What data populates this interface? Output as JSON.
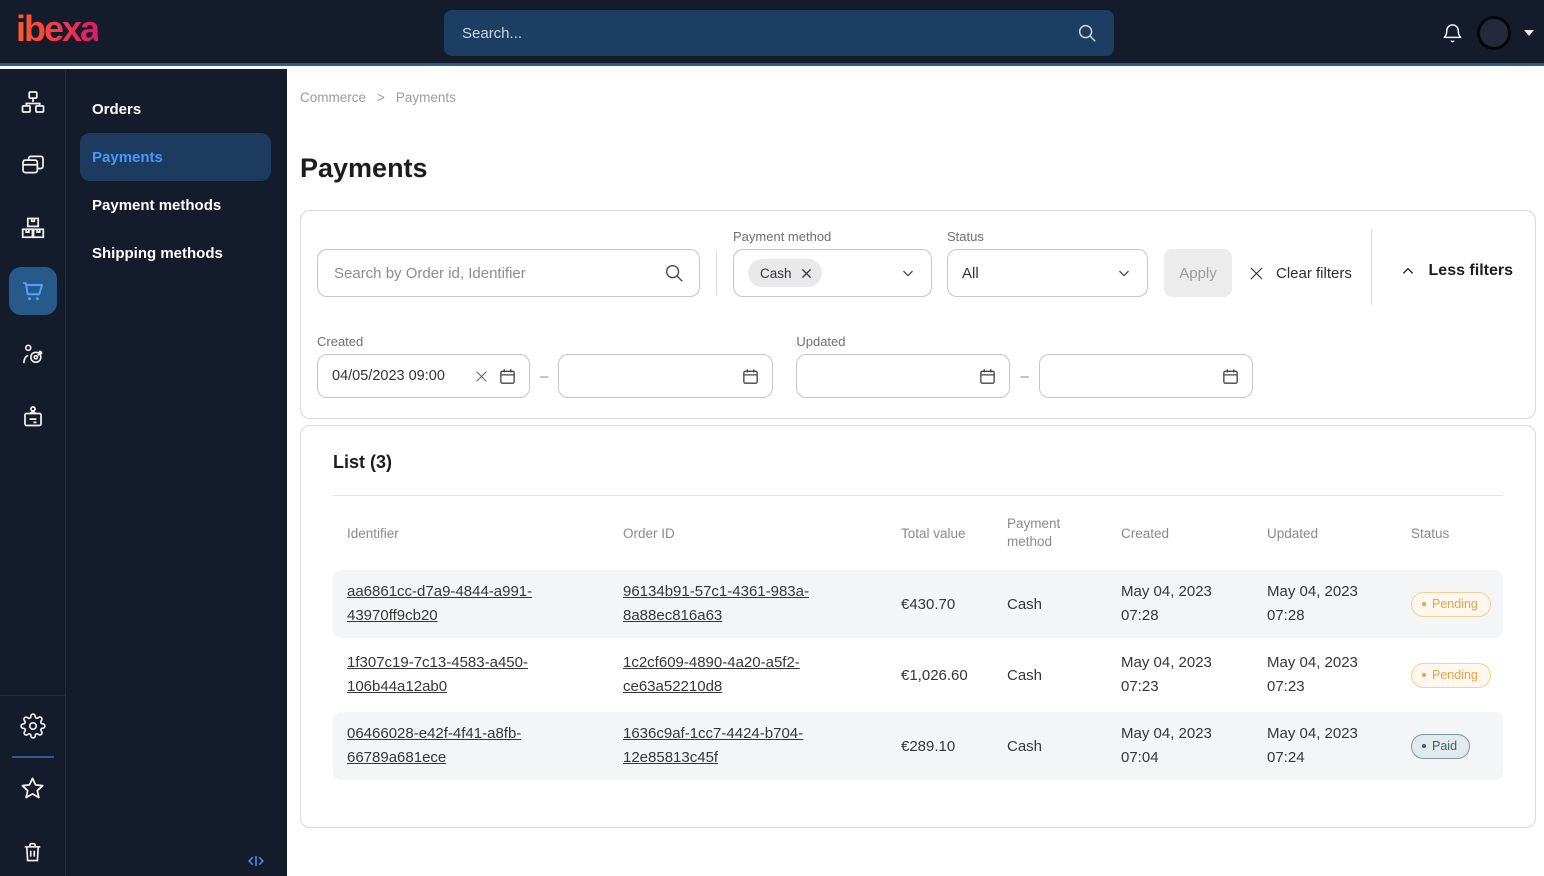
{
  "topbar": {
    "logo_text": "ibexa",
    "search_placeholder": "Search..."
  },
  "sidebar": {
    "rail_icons": [
      "site-structure-icon",
      "content-pages-icon",
      "products-boxes-icon",
      "commerce-cart-icon",
      "personalization-target-icon",
      "admin-badge-icon"
    ],
    "rail_bottom_icons": [
      "settings-gear-icon",
      "bookmarks-star-icon",
      "trash-icon"
    ],
    "menu": [
      {
        "label": "Orders",
        "active": false
      },
      {
        "label": "Payments",
        "active": true
      },
      {
        "label": "Payment methods",
        "active": false
      },
      {
        "label": "Shipping methods",
        "active": false
      }
    ]
  },
  "breadcrumb": {
    "items": [
      "Commerce",
      "Payments"
    ],
    "separator": ">"
  },
  "page_title": "Payments",
  "filters": {
    "search_placeholder": "Search by Order id, Identifier",
    "payment_method": {
      "label": "Payment method",
      "chip_label": "Cash"
    },
    "status": {
      "label": "Status",
      "value": "All"
    },
    "apply_label": "Apply",
    "clear_label": "Clear filters",
    "toggle_label": "Less filters",
    "range_separator": "–",
    "created": {
      "label": "Created",
      "from": "04/05/2023 09:00",
      "to": ""
    },
    "updated": {
      "label": "Updated",
      "from": "",
      "to": ""
    }
  },
  "list": {
    "title": "List (3)",
    "columns": [
      "Identifier",
      "Order ID",
      "Total value",
      "Payment method",
      "Created",
      "Updated",
      "Status"
    ],
    "rows": [
      {
        "identifier": "aa6861cc-d7a9-4844-a991-43970ff9cb20",
        "order_id": "96134b91-57c1-4361-983a-8a88ec816a63",
        "total_value": "€430.70",
        "payment_method": "Cash",
        "created": "May 04, 2023 07:28",
        "updated": "May 04, 2023 07:28",
        "status": "Pending"
      },
      {
        "identifier": "1f307c19-7c13-4583-a450-106b44a12ab0",
        "order_id": "1c2cf609-4890-4a20-a5f2-ce63a52210d8",
        "total_value": "€1,026.60",
        "payment_method": "Cash",
        "created": "May 04, 2023 07:23",
        "updated": "May 04, 2023 07:23",
        "status": "Pending"
      },
      {
        "identifier": "06466028-e42f-4f41-a8fb-66789a681ece",
        "order_id": "1636c9af-1cc7-4424-b704-12e85813c45f",
        "total_value": "€289.10",
        "payment_method": "Cash",
        "created": "May 04, 2023 07:04",
        "updated": "May 04, 2023 07:24",
        "status": "Paid"
      }
    ]
  },
  "colors": {
    "topbar_bg": "#141b2b",
    "topbar_accent_line": "#2e5c90",
    "active_menu_bg": "#1d3a5f",
    "active_menu_text": "#4799ff",
    "brand_gradient_start": "#ff5a2b",
    "brand_gradient_end": "#e0186c",
    "pending_badge": "#e9a14b",
    "paid_badge": "#39626b",
    "row_alt_bg": "#f4f5f6"
  }
}
